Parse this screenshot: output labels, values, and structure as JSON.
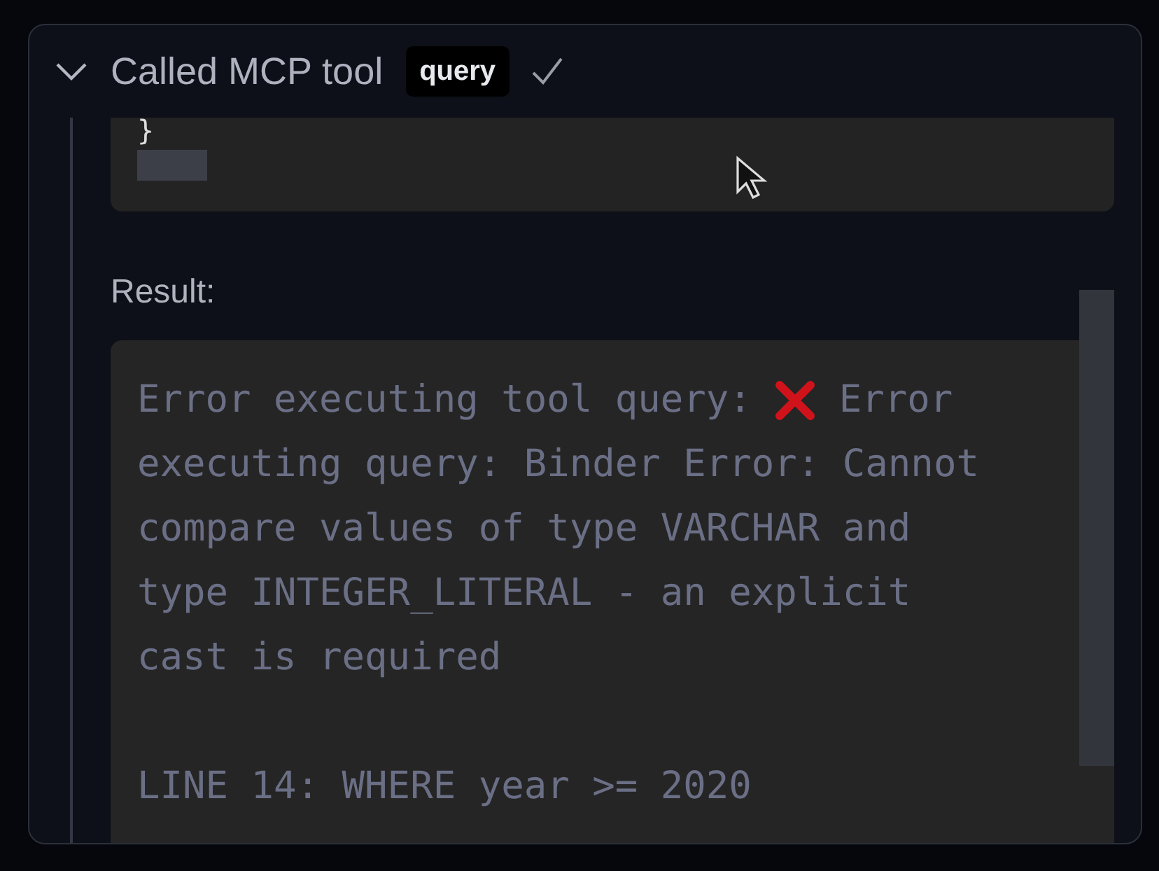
{
  "header": {
    "title": "Called MCP tool",
    "tool": "query",
    "expanded": true,
    "done": true
  },
  "code_block": {
    "text": "}"
  },
  "result": {
    "label": "Result:",
    "paragraphs": [
      [
        [
          {
            "kind": "text",
            "text": "Error executing tool query: "
          },
          {
            "kind": "error-icon"
          },
          {
            "kind": "text",
            "text": " Error"
          }
        ],
        [
          {
            "kind": "text",
            "text": "executing query: Binder Error: Cannot"
          }
        ],
        [
          {
            "kind": "text",
            "text": "compare values of type VARCHAR and"
          }
        ],
        [
          {
            "kind": "text",
            "text": "type INTEGER_LITERAL - an explicit"
          }
        ],
        [
          {
            "kind": "text",
            "text": "cast is required"
          }
        ]
      ],
      [
        [
          {
            "kind": "text",
            "text": "LINE 14: WHERE year >= 2020"
          }
        ]
      ]
    ]
  }
}
